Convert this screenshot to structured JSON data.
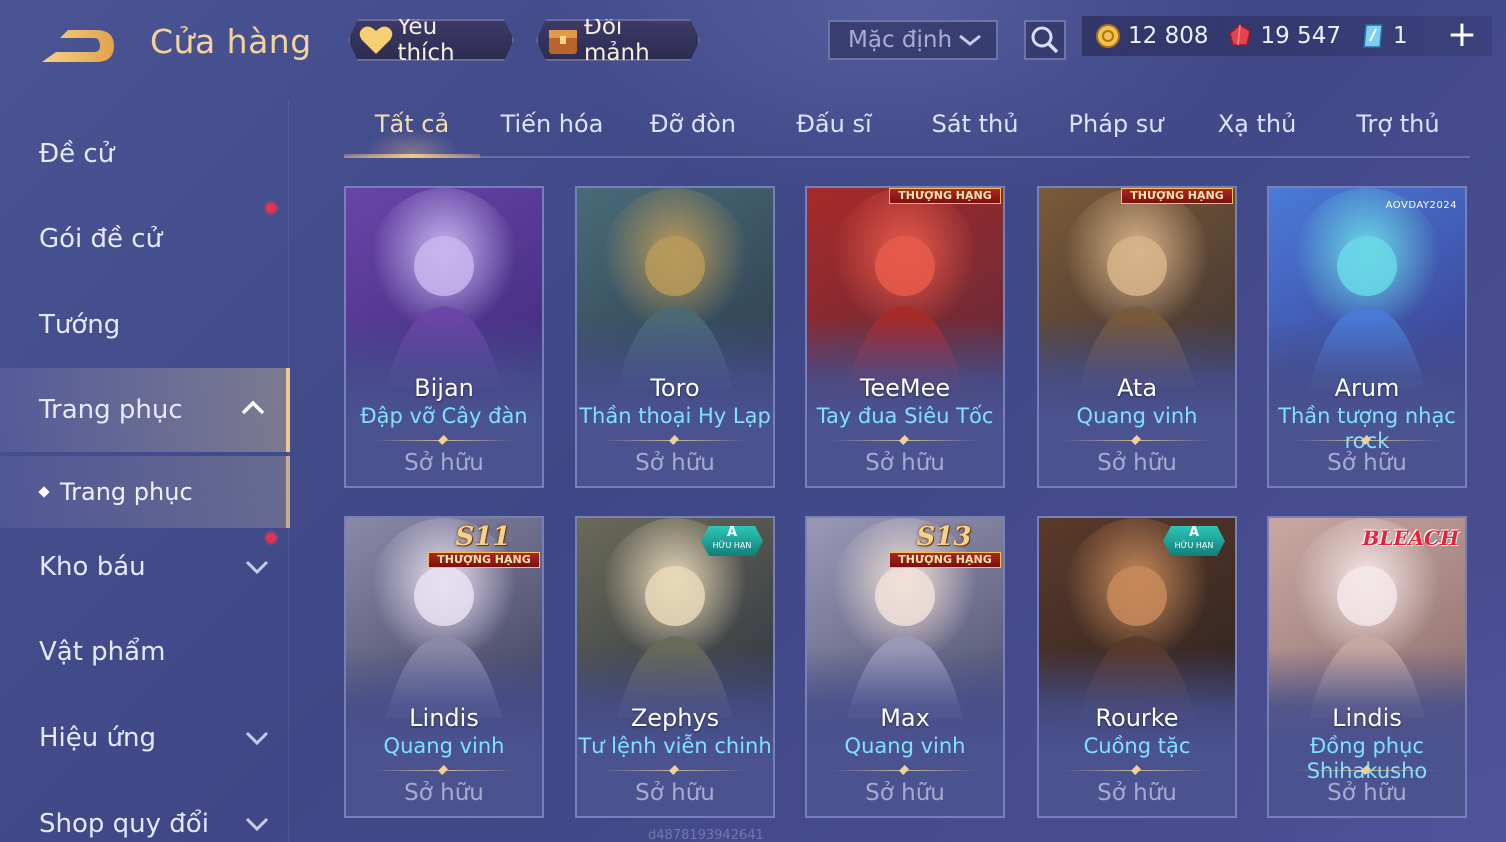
{
  "header": {
    "title": "Cửa hàng",
    "favorite_label": "Yêu thích",
    "shard_label": "Đổi mảnh",
    "sort_value": "Mặc định",
    "currencies": [
      {
        "icon": "gold-coin-icon",
        "value": "12 808"
      },
      {
        "icon": "ruby-gem-icon",
        "value": "19 547"
      },
      {
        "icon": "crystal-voucher-icon",
        "value": "1"
      }
    ],
    "add_icon": "plus-icon"
  },
  "sidebar": {
    "items": [
      {
        "label": "Đề cử",
        "has_dot": false
      },
      {
        "label": "Gói đề cử",
        "has_dot": true
      },
      {
        "label": "Tướng",
        "has_dot": false
      },
      {
        "label": "Trang phục",
        "active": true,
        "expanded": true
      },
      {
        "label": "Kho báu",
        "has_dot": true,
        "chevron": "down"
      },
      {
        "label": "Vật phẩm",
        "has_dot": false
      },
      {
        "label": "Hiệu ứng",
        "chevron": "down"
      },
      {
        "label": "Shop quy đổi",
        "chevron": "down"
      }
    ],
    "sub_item": "Trang phục"
  },
  "tabs": [
    "Tất cả",
    "Tiến hóa",
    "Đỡ đòn",
    "Đấu sĩ",
    "Sát thủ",
    "Pháp sư",
    "Xạ thủ",
    "Trợ thủ"
  ],
  "active_tab": "Tất cả",
  "cards": [
    {
      "hero": "Bijan",
      "skin": "Đập vỡ Cây đàn",
      "status": "Sở hữu",
      "badge": "",
      "colors": [
        "#c7b6f0",
        "#6a44a8",
        "#3b2a7a"
      ]
    },
    {
      "hero": "Toro",
      "skin": "Thần thoại Hy Lạp",
      "status": "Sở hữu",
      "badge": "",
      "colors": [
        "#b89a5a",
        "#4a6a78",
        "#2a3a4a"
      ]
    },
    {
      "hero": "TeeMee",
      "skin": "Tay đua Siêu Tốc",
      "status": "Sở hữu",
      "badge": "THƯỢNG HẠNG",
      "colors": [
        "#e85a4a",
        "#a82a2a",
        "#5a2a3a"
      ]
    },
    {
      "hero": "Ata",
      "skin": "Quang vinh",
      "status": "Sở hữu",
      "badge": "THƯỢNG HẠNG",
      "colors": [
        "#d8b48a",
        "#7a5a3a",
        "#3a3030"
      ]
    },
    {
      "hero": "Arum",
      "skin": "Thần tượng nhạc rock",
      "status": "Sở hữu",
      "badge": "AOVDAY2024",
      "colors": [
        "#6ad8e8",
        "#4a7ad8",
        "#3a3a8a"
      ]
    },
    {
      "hero": "Lindis",
      "skin": "Quang vinh",
      "status": "Sở hữu",
      "badge": "THƯỢNG HẠNG",
      "season": "S11",
      "colors": [
        "#e8e0f0",
        "#8a8aa8",
        "#3a3a5a"
      ]
    },
    {
      "hero": "Zephys",
      "skin": "Tư lệnh viễn chinh",
      "status": "Sở hữu",
      "badge": "A",
      "badge_sub": "HỮU HẠN",
      "colors": [
        "#e8d8b8",
        "#6a6a58",
        "#2a3040"
      ]
    },
    {
      "hero": "Max",
      "skin": "Quang vinh",
      "status": "Sở hữu",
      "badge": "THƯỢNG HẠNG",
      "season": "S13",
      "colors": [
        "#f0e0d8",
        "#9a9ab8",
        "#4a4a6a"
      ]
    },
    {
      "hero": "Rourke",
      "skin": "Cuồng tặc",
      "status": "Sở hữu",
      "badge": "A",
      "badge_sub": "HỮU HẠN",
      "colors": [
        "#c88a5a",
        "#5a3a2a",
        "#2a2020"
      ]
    },
    {
      "hero": "Lindis",
      "skin": "Đồng phục Shihakusho",
      "status": "Sở hữu",
      "badge": "BLEACH",
      "colors": [
        "#f4e8e8",
        "#c8a8a0",
        "#8a6a6a"
      ]
    }
  ],
  "watermark": "d4878193942641"
}
